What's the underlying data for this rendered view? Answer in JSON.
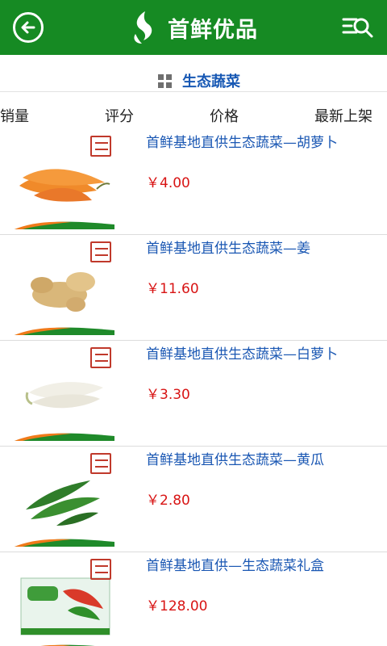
{
  "header": {
    "back_icon": "arrow-left-circle-icon",
    "brand_name": "首鲜优品",
    "logo_icon": "brand-logo-icon",
    "menu_icon": "list-search-icon",
    "bg_color": "#168a23"
  },
  "category": {
    "icon": "grid-icon",
    "title": "生态蔬菜"
  },
  "sort": [
    {
      "label": "销量"
    },
    {
      "label": "评分"
    },
    {
      "label": "价格"
    },
    {
      "label": "最新上架"
    }
  ],
  "products": [
    {
      "name": "首鲜基地直供生态蔬菜—胡萝卜",
      "price": "￥4.00",
      "image": "carrot"
    },
    {
      "name": "首鲜基地直供生态蔬菜—姜",
      "price": "￥11.60",
      "image": "ginger"
    },
    {
      "name": "首鲜基地直供生态蔬菜—白萝卜",
      "price": "￥3.30",
      "image": "white-radish"
    },
    {
      "name": "首鲜基地直供生态蔬菜—黄瓜",
      "price": "￥2.80",
      "image": "cucumber"
    },
    {
      "name": "首鲜基地直供—生态蔬菜礼盒",
      "price": "￥128.00",
      "image": "gift-box"
    }
  ],
  "colors": {
    "link": "#1758b4",
    "price": "#d81414",
    "accent_orange": "#f07a1a"
  }
}
